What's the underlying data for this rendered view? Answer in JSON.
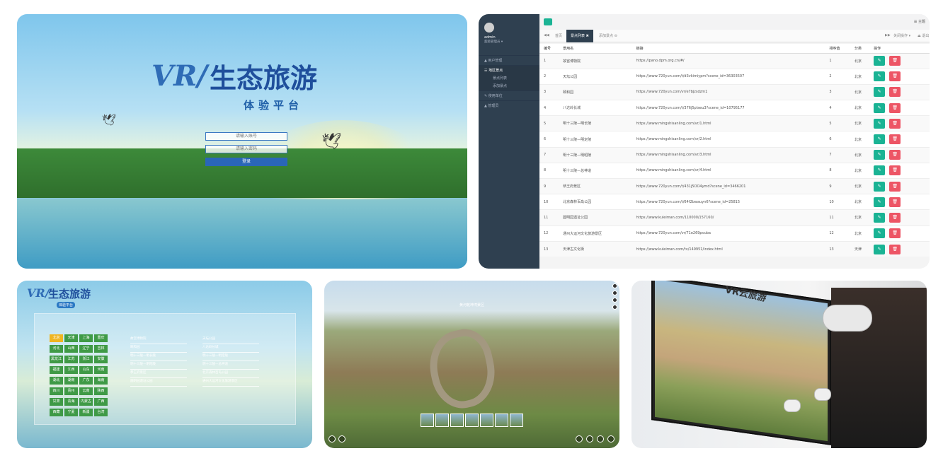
{
  "login": {
    "logo_vr": "VR/",
    "logo_title": "生态旅游",
    "logo_subtitle": "体验平台",
    "account_placeholder": "请输入账号",
    "password_placeholder": "请输入密码",
    "login_button": "登录"
  },
  "admin": {
    "user_name": "admin",
    "user_role": "超级管理员 ▾",
    "theme_label": "☰ 主题",
    "menu": [
      {
        "label": "▲ 用户管理",
        "arrow": "‹"
      },
      {
        "label": "☷ 地区景点",
        "arrow": "⌄"
      },
      {
        "label": "景点列表",
        "sub": true
      },
      {
        "label": "添加景点",
        "sub": true
      },
      {
        "label": "✎ 使用单位",
        "arrow": "‹"
      },
      {
        "label": "▲ 管理员",
        "arrow": "‹"
      }
    ],
    "tabs": {
      "prev": "◀◀",
      "home": "首页",
      "active": "景点列表 ✖",
      "other": "添加景点 ⊖",
      "next": "▶▶",
      "close_ops": "关闭操作 ▾",
      "exit": "⏏ 退出"
    },
    "columns": [
      "编号",
      "景用名",
      "链接",
      "排序值",
      "分类",
      "操作"
    ],
    "rows": [
      {
        "id": "1",
        "name": "故宫博物院",
        "link": "https://pano.dpm.org.cn/#/",
        "order": "1",
        "cat": "北京"
      },
      {
        "id": "2",
        "name": "天坛公园",
        "link": "https://www.720yun.com/t/d3vkimiypm?scene_id=36303507",
        "order": "2",
        "cat": "北京"
      },
      {
        "id": "3",
        "name": "颐和园",
        "link": "https://www.720yun.com/vr/e7bjzsdzm1",
        "order": "3",
        "cat": "北京"
      },
      {
        "id": "4",
        "name": "八达岭长城",
        "link": "https://www.720yun.com/t/376j5plaeu3?scene_id=10795177",
        "order": "4",
        "cat": "北京"
      },
      {
        "id": "5",
        "name": "明十三陵—明长陵",
        "link": "https://www.mingshisanling.com/vr/1.html",
        "order": "5",
        "cat": "北京"
      },
      {
        "id": "6",
        "name": "明十三陵—明定陵",
        "link": "https://www.mingshisanling.com/vr/2.html",
        "order": "6",
        "cat": "北京"
      },
      {
        "id": "7",
        "name": "明十三陵—明昭陵",
        "link": "https://www.mingshisanling.com/vr/3.html",
        "order": "7",
        "cat": "北京"
      },
      {
        "id": "8",
        "name": "明十三陵—总神道",
        "link": "https://www.mingshisanling.com/vr/4.html",
        "order": "8",
        "cat": "北京"
      },
      {
        "id": "9",
        "name": "恭王府景区",
        "link": "https://www.720yun.com/t/431j5OO4ymd?scene_id=3466201",
        "order": "9",
        "cat": "北京"
      },
      {
        "id": "10",
        "name": "北京森林百岛公园",
        "link": "https://www.720yun.com/t/64f2bwauyn6?scene_id=25815",
        "order": "10",
        "cat": "北京"
      },
      {
        "id": "11",
        "name": "圆明园遗址公园",
        "link": "https://www.kuleiman.com/110000/157160/",
        "order": "11",
        "cat": "北京"
      },
      {
        "id": "12",
        "name": "通州大运河文化旅游景区",
        "link": "https://www.720yun.com/vr/71e269pvuba",
        "order": "12",
        "cat": "北京"
      },
      {
        "id": "13",
        "name": "天津古文化街",
        "link": "https://www.kuleiman.com/tv/149951/index.html",
        "order": "13",
        "cat": "天津"
      }
    ]
  },
  "selector": {
    "logo_vr": "VR/",
    "logo_title": "生态旅游",
    "logo_subtitle": "体验平台",
    "provinces": [
      "北京",
      "天津",
      "上海",
      "重庆",
      "河北",
      "山西",
      "辽宁",
      "吉林",
      "黑龙江",
      "江苏",
      "浙江",
      "安徽",
      "福建",
      "江西",
      "山东",
      "河南",
      "湖北",
      "湖南",
      "广东",
      "海南",
      "四川",
      "贵州",
      "云南",
      "陕西",
      "甘肃",
      "青海",
      "内蒙古",
      "广西",
      "西藏",
      "宁夏",
      "新疆",
      "台湾"
    ],
    "selected": "北京",
    "spots_col1": [
      "故宫博物院",
      "颐和园",
      "明十三陵—明长陵",
      "明十三陵—明昭陵",
      "恭王府景区",
      "圆明园遗址公园"
    ],
    "spots_col2": [
      "天坛公园",
      "八达岭长城",
      "明十三陵—明定陵",
      "明十三陵—总神道",
      "北京森林百岛公园",
      "通州大运河文化旅游景区"
    ]
  },
  "panorama": {
    "title": "黄河乾坤湾景区"
  },
  "photo": {
    "sign": "VR云旅游"
  }
}
